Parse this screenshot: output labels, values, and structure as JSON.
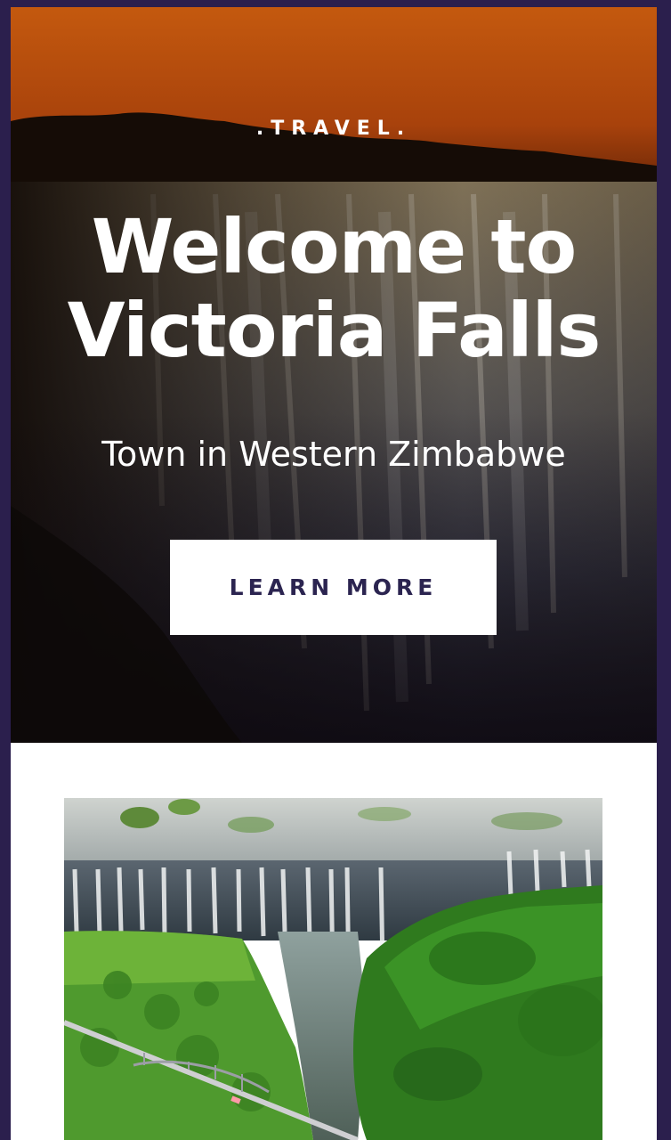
{
  "hero": {
    "eyebrow": ".TRAVEL.",
    "title_line1": "Welcome to",
    "title_line2": "Victoria Falls",
    "subtitle": "Town in Western Zimbabwe",
    "cta_label": "LEARN MORE",
    "background_image": "sunset-waterfall-photo"
  },
  "gallery": {
    "image": "aerial-waterfall-bridge-photo"
  },
  "colors": {
    "page_border": "#2b1f4d",
    "sky_top": "#c4590e",
    "cta_background": "#ffffff",
    "cta_text": "#2b2450"
  }
}
